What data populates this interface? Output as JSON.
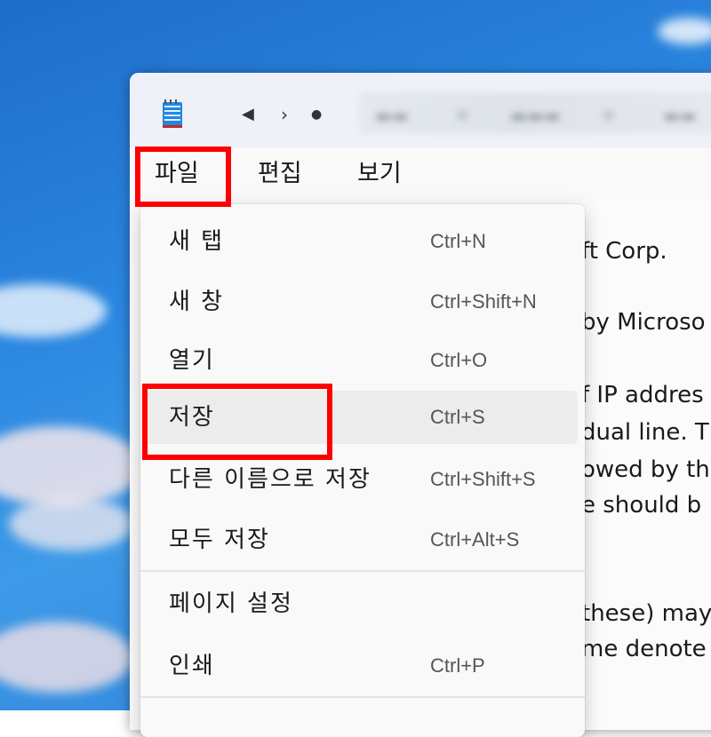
{
  "menubar": {
    "items": [
      {
        "label": "파일"
      },
      {
        "label": "편집"
      },
      {
        "label": "보기"
      }
    ]
  },
  "file_menu": {
    "items": [
      {
        "label": "새 탭",
        "shortcut": "Ctrl+N"
      },
      {
        "label": "새 창",
        "shortcut": "Ctrl+Shift+N"
      },
      {
        "label": "열기",
        "shortcut": "Ctrl+O"
      },
      {
        "label": "저장",
        "shortcut": "Ctrl+S",
        "state": "hovered"
      },
      {
        "label": "다른 이름으로 저장",
        "shortcut": "Ctrl+Shift+S"
      },
      {
        "label": "모두 저장",
        "shortcut": "Ctrl+Alt+S"
      },
      {
        "label": "페이지 설정",
        "shortcut": ""
      },
      {
        "label": "인쇄",
        "shortcut": "Ctrl+P"
      }
    ]
  },
  "document": {
    "lines": [
      "ft Corp.",
      "by Microso",
      "f IP addres",
      "dual line. T",
      "owed by th",
      "e should b",
      "these) may",
      "me denote"
    ]
  },
  "colors": {
    "highlight": "#ff0000",
    "menu_hover": "#ececec",
    "desktop": "#2a86e0"
  },
  "icons": {
    "app": "notepad-icon",
    "back": "back-arrow-icon",
    "forward": "forward-icon",
    "dot": "tab-dot-icon"
  }
}
